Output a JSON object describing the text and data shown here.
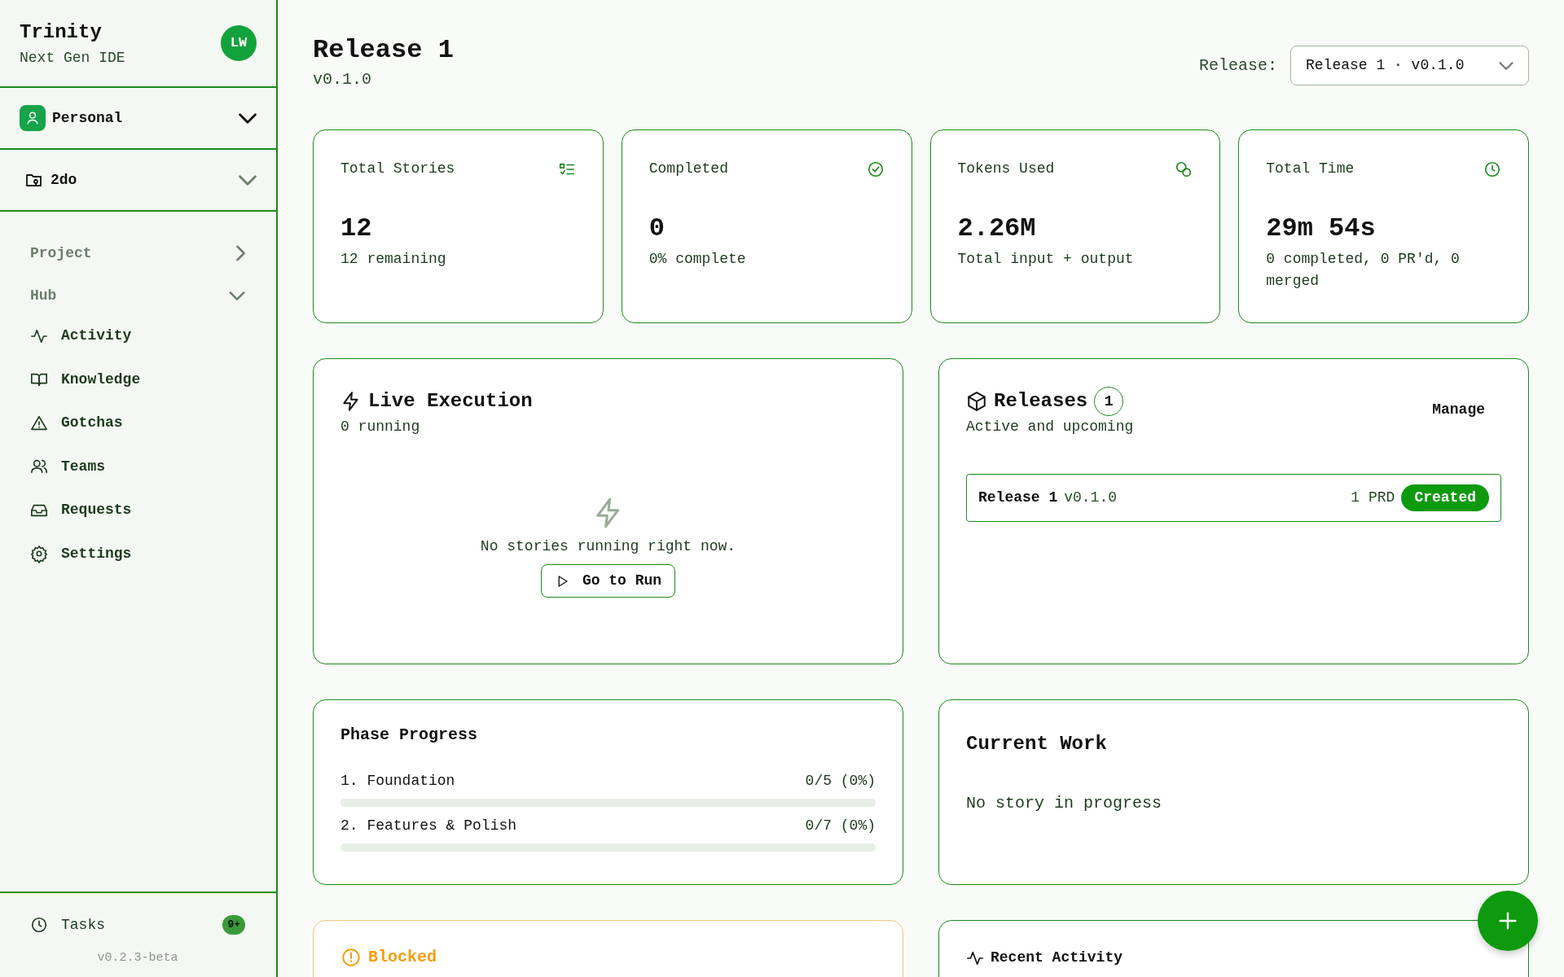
{
  "sidebar": {
    "brand": {
      "title": "Trinity",
      "subtitle": "Next Gen IDE"
    },
    "avatar": "LW",
    "workspace": "Personal",
    "project": "2do",
    "sections": [
      {
        "label": "Project",
        "expanded": false
      },
      {
        "label": "Hub",
        "expanded": true,
        "items": [
          "Activity",
          "Knowledge",
          "Gotchas",
          "Teams",
          "Requests",
          "Settings"
        ]
      }
    ],
    "tasks": {
      "label": "Tasks",
      "badge": "9+"
    },
    "version": "v0.2.3-beta"
  },
  "header": {
    "title": "Release 1",
    "version": "v0.1.0",
    "release_select": {
      "label": "Release:",
      "value": "Release 1 · v0.1.0"
    }
  },
  "stats": [
    {
      "label": "Total Stories",
      "value": "12",
      "note": "12 remaining"
    },
    {
      "label": "Completed",
      "value": "0",
      "note": "0% complete"
    },
    {
      "label": "Tokens Used",
      "value": "2.26M",
      "note": "Total input + output"
    },
    {
      "label": "Total Time",
      "value": "29m 54s",
      "note": "0 completed, 0 PR'd, 0 merged"
    }
  ],
  "live": {
    "title": "Live Execution",
    "subtitle": "0 running",
    "empty_text": "No stories running right now.",
    "button": "Go to Run"
  },
  "releases": {
    "title": "Releases",
    "count": "1",
    "subtitle": "Active and upcoming",
    "action": "Manage",
    "items": [
      {
        "name": "Release 1",
        "version": "v0.1.0",
        "prd": "1 PRD",
        "status": "Created"
      }
    ]
  },
  "phase": {
    "title": "Phase Progress",
    "phases": [
      {
        "label": "1. Foundation",
        "count": "0/5 (0%)",
        "level": 0
      },
      {
        "label": "2. Features & Polish",
        "count": "0/7 (0%)",
        "level": 0
      }
    ]
  },
  "current_work": {
    "title": "Current Work",
    "text": "No story in progress"
  },
  "blocked": {
    "title": "Blocked"
  },
  "recent": {
    "title": "Recent Activity"
  }
}
